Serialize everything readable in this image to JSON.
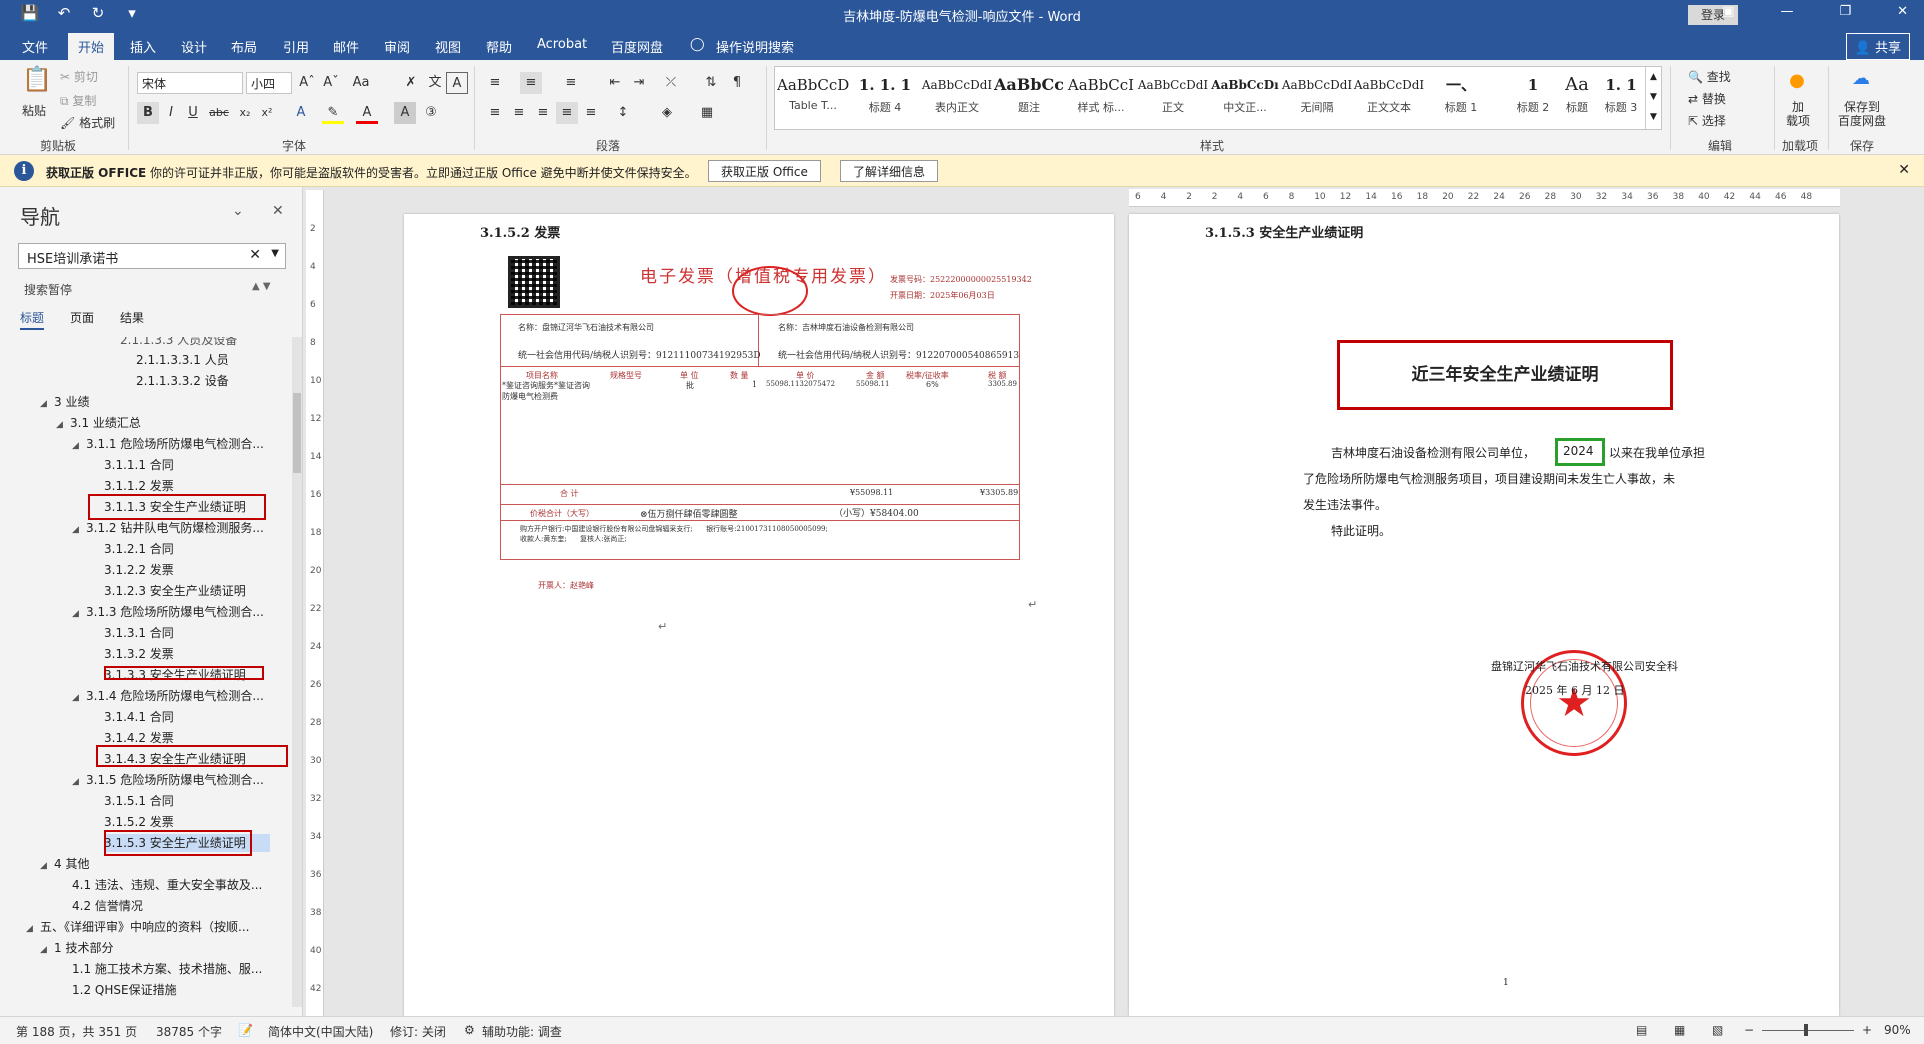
{
  "titlebar": {
    "doc_title": "吉林坤度-防爆电气检测-响应文件  -  Word",
    "login": "登录",
    "qat": [
      "save-icon",
      "undo-icon",
      "redo-icon",
      "customize-icon"
    ]
  },
  "tabs": [
    "文件",
    "开始",
    "插入",
    "设计",
    "布局",
    "引用",
    "邮件",
    "审阅",
    "视图",
    "帮助",
    "Acrobat",
    "百度网盘",
    "操作说明搜索"
  ],
  "share": "共享",
  "ribbon": {
    "clipboard": {
      "paste": "粘贴",
      "cut": "剪切",
      "copy": "复制",
      "format_painter": "格式刷",
      "label": "剪贴板"
    },
    "font": {
      "name": "宋体",
      "size": "小四",
      "label": "字体"
    },
    "paragraph": {
      "label": "段落"
    },
    "styles": {
      "label": "样式",
      "items": [
        {
          "preview": "AaBbCcDı",
          "name": "Table T..."
        },
        {
          "preview": "1. 1. 1",
          "name": "标题 4"
        },
        {
          "preview": "AaBbCcDdI",
          "name": "表内正文"
        },
        {
          "preview": "AaBbCc",
          "name": "题注"
        },
        {
          "preview": "AaBbCcI",
          "name": "样式 标..."
        },
        {
          "preview": "AaBbCcDdI",
          "name": "正文"
        },
        {
          "preview": "AaBbCcDı",
          "name": "中文正..."
        },
        {
          "preview": "AaBbCcDdI",
          "name": "无间隔"
        },
        {
          "preview": "AaBbCcDdI",
          "name": "正文文本"
        },
        {
          "preview": "一、",
          "name": "标题 1"
        },
        {
          "preview": "1",
          "name": "标题 2"
        },
        {
          "preview": "Aa",
          "name": "标题"
        },
        {
          "preview": "1. 1",
          "name": "标题 3"
        }
      ]
    },
    "editing": {
      "find": "查找",
      "replace": "替换",
      "select": "选择",
      "label": "编辑"
    },
    "addins": {
      "btn": "加\n载项",
      "label": "加载项"
    },
    "baidu": {
      "btn": "保存到\n百度网盘",
      "label": "保存"
    }
  },
  "notice": {
    "title": "获取正版 OFFICE",
    "message": "你的许可证并非正版，你可能是盗版软件的受害者。立即通过正版 Office 避免中断并使文件保持安全。",
    "btn1": "获取正版 Office",
    "btn2": "了解详细信息"
  },
  "nav": {
    "title": "导航",
    "search": "HSE培训承诺书",
    "paused": "搜索暂停",
    "tabs": [
      "标题",
      "页面",
      "结果"
    ],
    "items": [
      {
        "text": "2.1.1.3.3 人员及设备"
      },
      {
        "text": "2.1.1.3.3.1 人员"
      },
      {
        "text": "2.1.1.3.3.2 设备"
      },
      {
        "text": "3 业绩"
      },
      {
        "text": "3.1 业绩汇总"
      },
      {
        "text": "3.1.1 危险场所防爆电气检测合..."
      },
      {
        "text": "3.1.1.1 合同"
      },
      {
        "text": "3.1.1.2 发票"
      },
      {
        "text": "3.1.1.3 安全生产业绩证明"
      },
      {
        "text": "3.1.2 钻井队电气防爆检测服务..."
      },
      {
        "text": "3.1.2.1 合同"
      },
      {
        "text": "3.1.2.2 发票"
      },
      {
        "text": "3.1.2.3 安全生产业绩证明"
      },
      {
        "text": "3.1.3 危险场所防爆电气检测合..."
      },
      {
        "text": "3.1.3.1 合同"
      },
      {
        "text": "3.1.3.2 发票"
      },
      {
        "text": "3.1.3.3 安全生产业绩证明"
      },
      {
        "text": "3.1.4 危险场所防爆电气检测合..."
      },
      {
        "text": "3.1.4.1 合同"
      },
      {
        "text": "3.1.4.2 发票"
      },
      {
        "text": "3.1.4.3 安全生产业绩证明"
      },
      {
        "text": "3.1.5 危险场所防爆电气检测合..."
      },
      {
        "text": "3.1.5.1 合同"
      },
      {
        "text": "3.1.5.2 发票"
      },
      {
        "text": "3.1.5.3 安全生产业绩证明"
      },
      {
        "text": "4 其他"
      },
      {
        "text": "4.1 违法、违规、重大安全事故及..."
      },
      {
        "text": "4.2 信誉情况"
      },
      {
        "text": "五、《详细评审》中响应的资料（按顺..."
      },
      {
        "text": "1 技术部分"
      },
      {
        "text": "1.1 施工技术方案、技术措施、服..."
      },
      {
        "text": "1.2 QHSE保证措施"
      }
    ]
  },
  "hruler_ticks": [
    "6",
    "4",
    "2",
    "2",
    "4",
    "6",
    "8",
    "10",
    "12",
    "14",
    "16",
    "18",
    "20",
    "22",
    "24",
    "26",
    "28",
    "30",
    "32",
    "34",
    "36",
    "38",
    "40",
    "42",
    "44",
    "46",
    "48"
  ],
  "vruler_ticks": [
    "2",
    "4",
    "6",
    "8",
    "10",
    "12",
    "14",
    "16",
    "18",
    "20",
    "22",
    "24",
    "26",
    "28",
    "30",
    "32",
    "34",
    "36",
    "38",
    "40",
    "42"
  ],
  "page_left": {
    "heading": "3.1.5.2    发票",
    "invoice": {
      "title": "电子发票（增值税专用发票）",
      "number_label": "发票号码：25222000000025519342",
      "date_label": "开票日期：2025年06月03日",
      "buyer_label": "名称：盘锦辽河华飞石油技术有限公司",
      "buyer_tax": "统一社会信用代码/纳税人识别号：91211100734192953D",
      "seller_label": "名称：吉林坤度石油设备检测有限公司",
      "seller_tax": "统一社会信用代码/纳税人识别号：912207000540865913",
      "columns": [
        "项目名称",
        "规格型号",
        "单 位",
        "数 量",
        "单 价",
        "金 额",
        "税率/征收率",
        "税 额"
      ],
      "item_name": "*鉴证咨询服务*鉴证咨询\n防爆电气检测费",
      "item_unit": "批",
      "item_qty": "1",
      "item_price": "55098.1132075472",
      "item_amount": "55098.11",
      "item_rate": "6%",
      "item_tax": "3305.89",
      "subtotal_label": "合        计",
      "subtotal_amount": "¥55098.11",
      "subtotal_tax": "¥3305.89",
      "total_words_label": "价税合计（大写）",
      "total_words": "⊗伍万捌仟肆佰零肆圆整",
      "total_small": "（小写）¥58404.00",
      "remarks": "购方开户银行:中国建设银行股份有限公司盘锦辐采支行;      银行账号:21001731108050005099;\n收款人:黄东奎;      复核人:张尚正;",
      "issuer": "开票人：赵艳峰"
    }
  },
  "page_right": {
    "heading": "3.1.5.3    安全生产业绩证明",
    "cert_title": "近三年安全生产业绩证明",
    "body_1a": "吉林坤度石油设备检测有限公司单位，",
    "body_year": "2024",
    "body_1b": "以来在我单位承担",
    "body_2": "了危险场所防爆电气检测服务项目，项目建设期间未发生亡人事故，未",
    "body_3": "发生违法事件。",
    "body_4": "特此证明。",
    "sign_org": "盘锦辽河华飞石油技术有限公司安全科",
    "sign_date": "2025 年 6 月 12 日",
    "page_no": "1"
  },
  "status": {
    "page": "第 188 页，共 351 页",
    "words": "38785 个字",
    "lang": "简体中文(中国大陆)",
    "track": "修订: 关闭",
    "access": "辅助功能: 调查",
    "zoom": "90%"
  },
  "colors": {
    "brand": "#2b579a",
    "highlight_red": "#c00000",
    "highlight_green": "#2ca02c",
    "notice_bg": "#fff4ce"
  }
}
